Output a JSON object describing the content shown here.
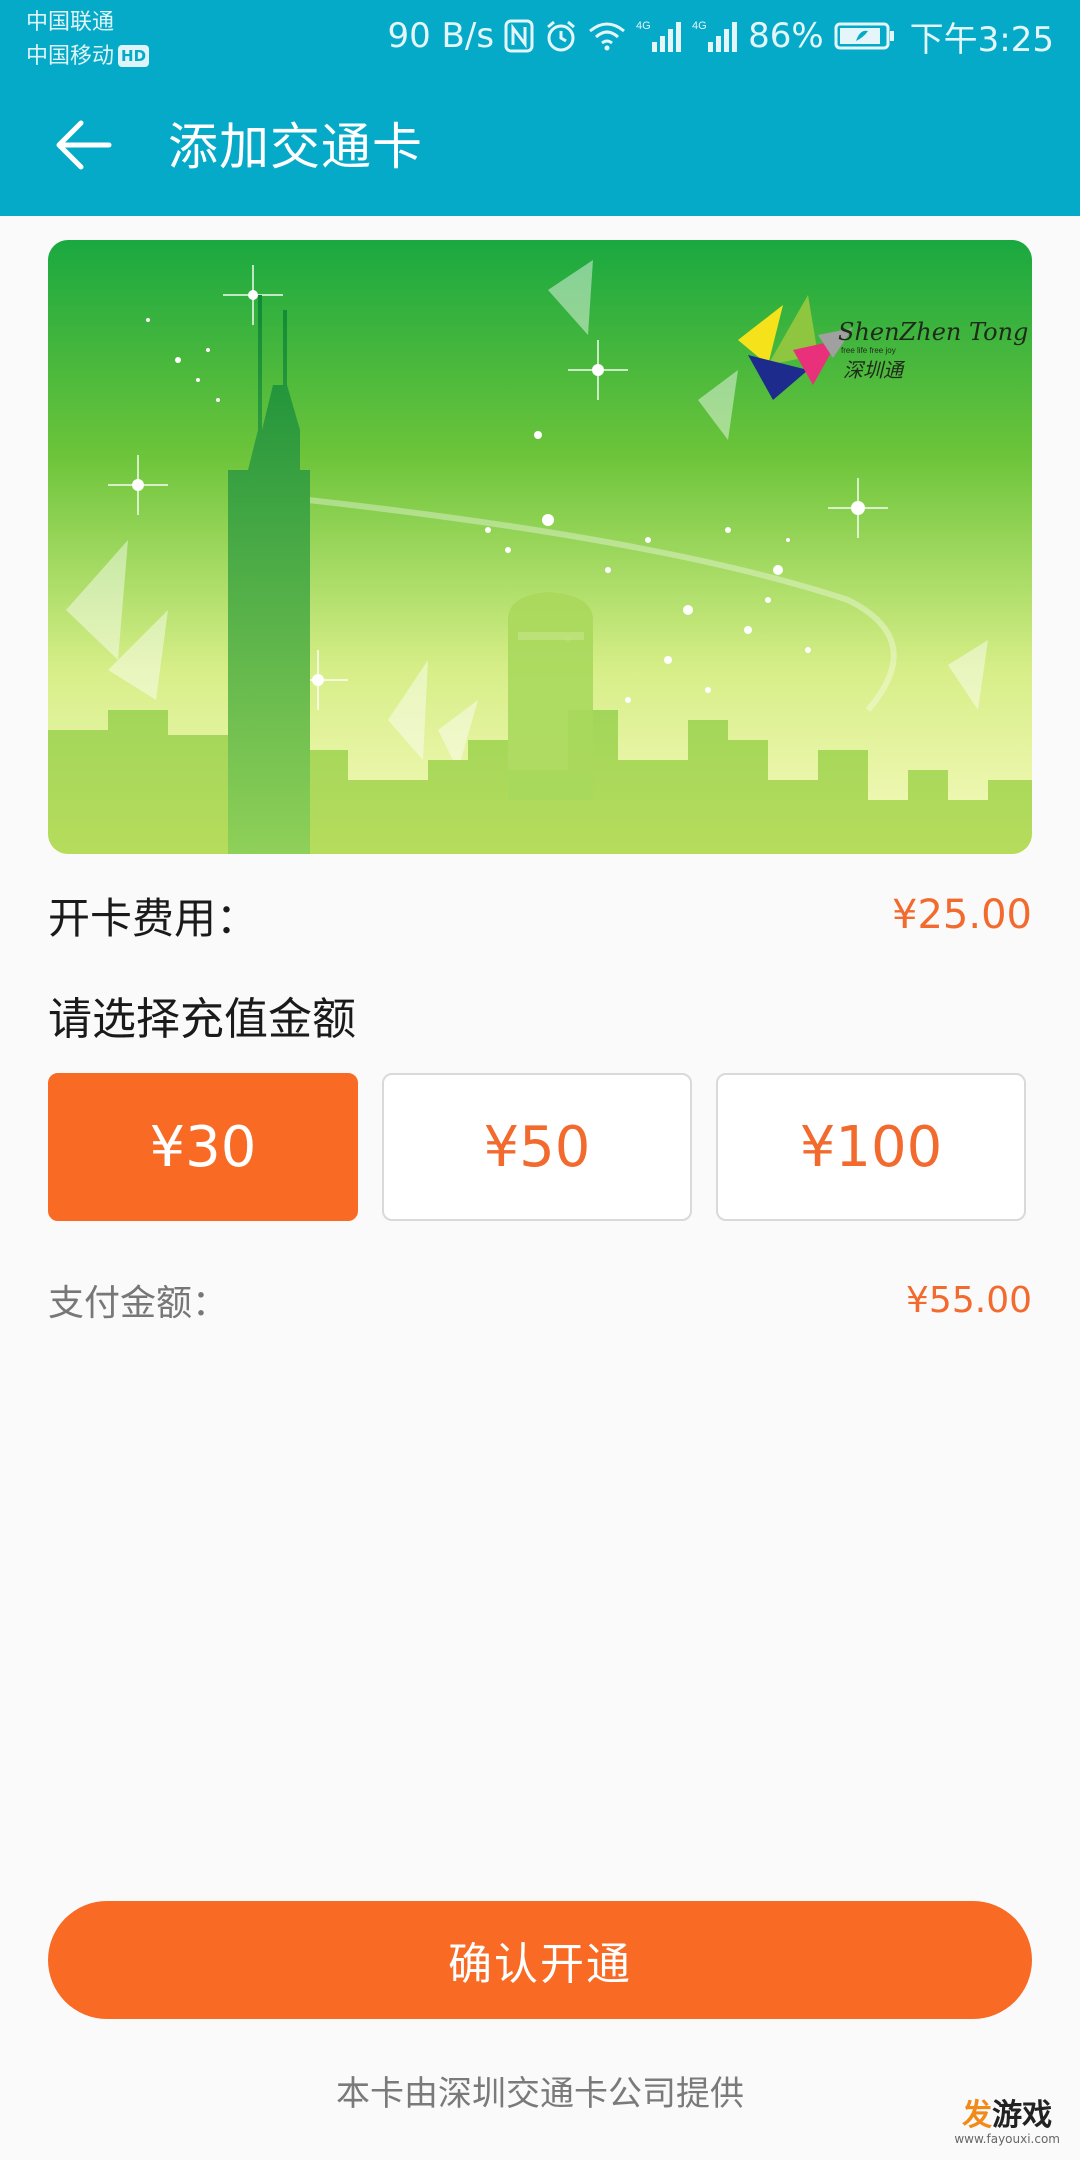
{
  "status_bar": {
    "carrier_1": "中国联通",
    "carrier_2": "中国移动",
    "hd_badge": "HD",
    "net_speed": "90 B/s",
    "network_1": "4G",
    "network_2": "4G",
    "battery_pct": "86%",
    "time": "下午3:25",
    "icons": [
      "nfc-icon",
      "alarm-icon",
      "wifi-icon",
      "signal-icon",
      "signal-icon",
      "battery-icon"
    ]
  },
  "app_bar": {
    "title": "添加交通卡",
    "back_icon": "arrow-left-icon"
  },
  "card": {
    "brand_name": "ShenZhen Tong",
    "brand_slogan": "free life free joy",
    "brand_cn": "深圳通"
  },
  "fee": {
    "label": "开卡费用：",
    "value": "¥25.00"
  },
  "recharge": {
    "title": "请选择充值金额",
    "options": [
      "¥30",
      "¥50",
      "¥100"
    ],
    "selected_index": 0
  },
  "payment": {
    "label": "支付金额：",
    "value": "¥55.00"
  },
  "confirm_label": "确认开通",
  "footer_note": "本卡由深圳交通卡公司提供",
  "watermark": {
    "part1": "发",
    "part2": "游戏",
    "url": "www.fayouxi.com"
  },
  "colors": {
    "app_bar": "#05aac8",
    "accent": "#f96a24",
    "price": "#f26a2e"
  }
}
